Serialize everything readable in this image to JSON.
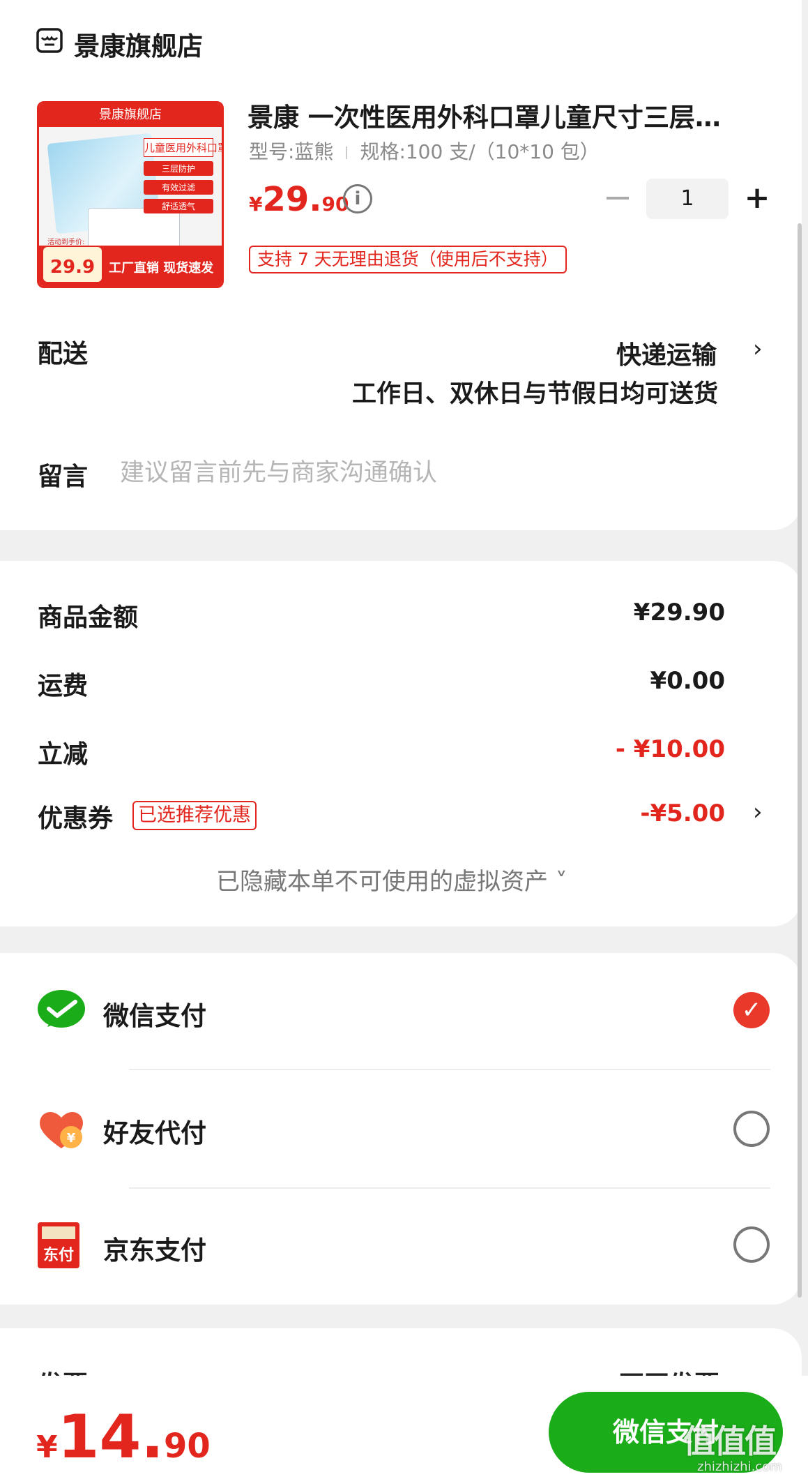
{
  "store": {
    "name": "景康旗舰店",
    "icon": "store-icon"
  },
  "product": {
    "title": "景康 一次性医用外科口罩儿童尺寸三层…",
    "model": "型号:蓝熊",
    "spec": "规格:100 支/（10*10 包）",
    "price_symbol": "¥",
    "price_int": "29.",
    "price_dec": "90",
    "quantity": "1",
    "return_policy": "支持 7 天无理由退货（使用后不支持）",
    "image": {
      "banner": "景康旗舰店",
      "tag_main": "儿童医用外科口罩",
      "tag_features": [
        "三层防护",
        "有效过滤",
        "舒适透气"
      ],
      "activity_label": "活动到手价:",
      "activity_price": "29.9",
      "slogan": "工厂直销 现货速发"
    }
  },
  "delivery": {
    "label": "配送",
    "mode": "快递运输",
    "note": "工作日、双休日与节假日均可送货"
  },
  "message": {
    "label": "留言",
    "placeholder": "建议留言前先与商家沟通确认"
  },
  "amounts": {
    "goods_label": "商品金额",
    "goods_value": "¥29.90",
    "shipping_label": "运费",
    "shipping_value": "¥0.00",
    "discount_label": "立减",
    "discount_value": "- ¥10.00",
    "coupon_label": "优惠券",
    "coupon_tag": "已选推荐优惠",
    "coupon_value": "-¥5.00",
    "hidden_assets": "已隐藏本单不可使用的虚拟资产 ˅"
  },
  "payment": {
    "methods": [
      {
        "label": "微信支付",
        "icon": "wechat-pay-icon",
        "selected": true
      },
      {
        "label": "好友代付",
        "icon": "friend-pay-icon",
        "selected": false
      },
      {
        "label": "京东支付",
        "icon": "jd-pay-icon",
        "selected": false
      }
    ]
  },
  "peek": {
    "left": "发票",
    "right": "不开发票 ›"
  },
  "footer": {
    "total_symbol": "¥",
    "total_int": "14.",
    "total_dec": "90",
    "pay_button": "微信支付"
  },
  "watermark": {
    "text": "值值值",
    "url": "zhizhizhi.com"
  },
  "colors": {
    "accent_red": "#e3261d",
    "wechat_green": "#1aad19"
  }
}
